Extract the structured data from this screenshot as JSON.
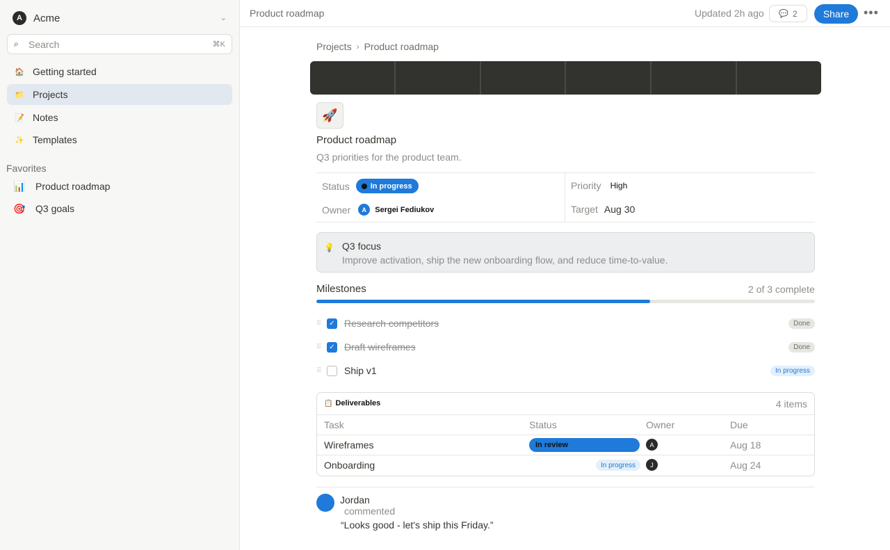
{
  "sidebar": {
    "workspace": {
      "initial": "A",
      "name": "Acme"
    },
    "search": {
      "placeholder": "Search",
      "shortcut": "⌘K"
    },
    "nav": [
      {
        "label": "Getting started",
        "icon": "house-icon"
      },
      {
        "label": "Projects",
        "icon": "folder-icon",
        "active": true
      },
      {
        "label": "Notes",
        "icon": "note-icon"
      },
      {
        "label": "Templates",
        "icon": "sparkles-icon"
      }
    ],
    "favorites_title": "Favorites",
    "favorites": [
      {
        "label": "Product roadmap",
        "icon": "bar-chart-icon"
      },
      {
        "label": "Q3 goals",
        "icon": "target-icon"
      }
    ]
  },
  "topbar": {
    "title": "Product roadmap",
    "updated": "Updated 2h ago",
    "comment_count": "2",
    "share": "Share"
  },
  "breadcrumb": [
    "Projects",
    "Product roadmap"
  ],
  "page": {
    "title": "Product roadmap",
    "subtitle": "Q3 priorities for the product team."
  },
  "properties": {
    "status_key": "Status",
    "status_value": "In progress",
    "owner_key": "Owner",
    "owner_initial": "A",
    "owner_name": "Sergei Fediukov",
    "priority_key": "Priority",
    "priority_value": "High",
    "target_key": "Target",
    "target_value": "Aug 30"
  },
  "callout": {
    "title": "Q3 focus",
    "body": "Improve activation, ship the new onboarding flow, and reduce time-to-value."
  },
  "milestones": {
    "title": "Milestones",
    "count": "2 of 3 complete",
    "progress_percent": 67,
    "items": [
      {
        "label": "Research competitors",
        "done": true,
        "status": "Done"
      },
      {
        "label": "Draft wireframes",
        "done": true,
        "status": "Done"
      },
      {
        "label": "Ship v1",
        "done": false,
        "status": "In progress"
      }
    ]
  },
  "deliverables": {
    "title": "Deliverables",
    "count": "4 items",
    "columns": [
      "Task",
      "Status",
      "Owner",
      "Due"
    ],
    "rows": [
      {
        "task": "Wireframes",
        "status": "In review",
        "owner": "A",
        "due": "Aug 18"
      },
      {
        "task": "Onboarding",
        "status": "In progress",
        "owner": "J",
        "due": "Aug 24"
      }
    ]
  },
  "comment": {
    "author": "Jordan",
    "action": "commented",
    "text": "“Looks good - let's ship this Friday.”"
  },
  "colors": {
    "accent": "#1f7ad9",
    "sidebar_bg": "#f7f7f5",
    "cover": "#32322e"
  }
}
